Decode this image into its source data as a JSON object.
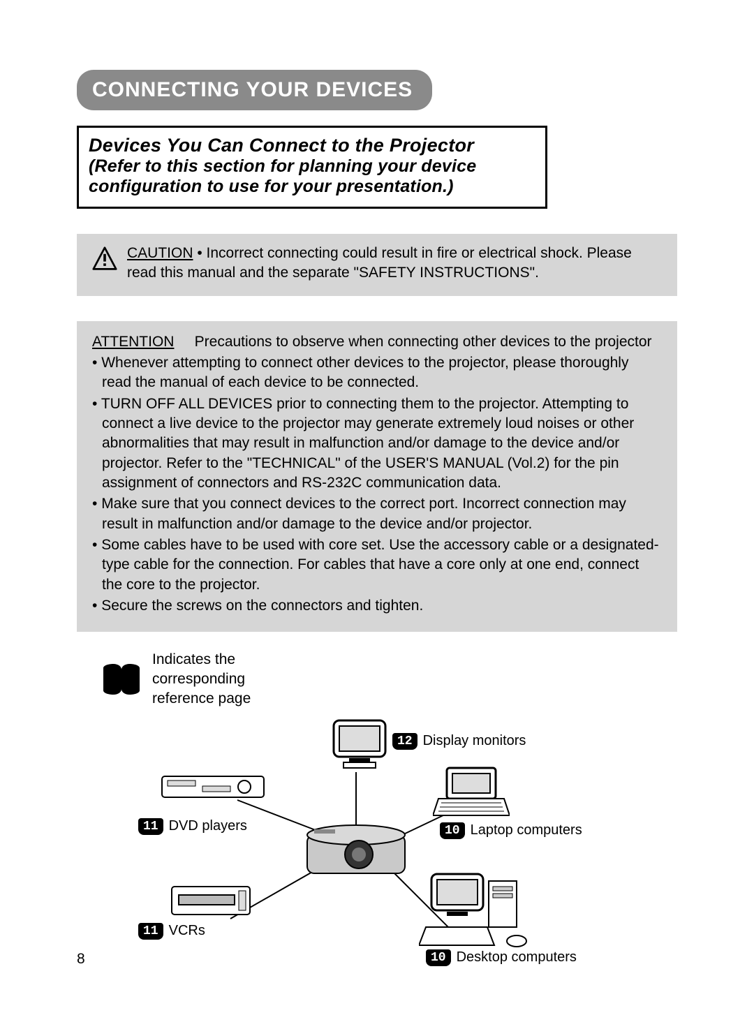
{
  "section_title": "CONNECTING YOUR DEVICES",
  "subhead": {
    "line1": "Devices You Can Connect to the Projector",
    "line2": "(Refer to this section for planning your device configuration to use for your presentation.)"
  },
  "caution": {
    "label": "CAUTION",
    "text": "• Incorrect connecting could result in fire or electrical shock. Please read this manual and the separate \"SAFETY INSTRUCTIONS\"."
  },
  "attention": {
    "label": "ATTENTION",
    "intro": "Precautions to observe when connecting other devices to the projector",
    "bullets": [
      "Whenever attempting to connect other devices to the projector, please thoroughly read the manual of each device to be connected.",
      "TURN OFF ALL DEVICES prior to connecting them to the projector. Attempting to connect a live device to the projector may generate extremely loud noises or other abnormalities that may result in malfunction and/or damage to the device and/or projector. Refer to the \"TECHNICAL\" of the USER'S MANUAL (Vol.2) for the pin assignment of connectors and RS-232C communication data.",
      "Make sure that you connect devices to the correct port. Incorrect connection may result in malfunction and/or damage to the device and/or projector.",
      "Some cables have to be used with core set. Use the accessory cable or a designated-type cable for the connection. For cables that have a core only at one end, connect the core to the projector.",
      "Secure the screws on the connectors and tighten."
    ]
  },
  "legend_text": "Indicates the corresponding reference page",
  "devices": {
    "display_monitors": {
      "ref": "12",
      "label": "Display monitors"
    },
    "laptop_computers": {
      "ref": "10",
      "label": "Laptop computers"
    },
    "desktop_computers": {
      "ref": "10",
      "label": "Desktop computers"
    },
    "dvd_players": {
      "ref": "11",
      "label": "DVD players"
    },
    "vcrs": {
      "ref": "11",
      "label": "VCRs"
    }
  },
  "page_number": "8"
}
